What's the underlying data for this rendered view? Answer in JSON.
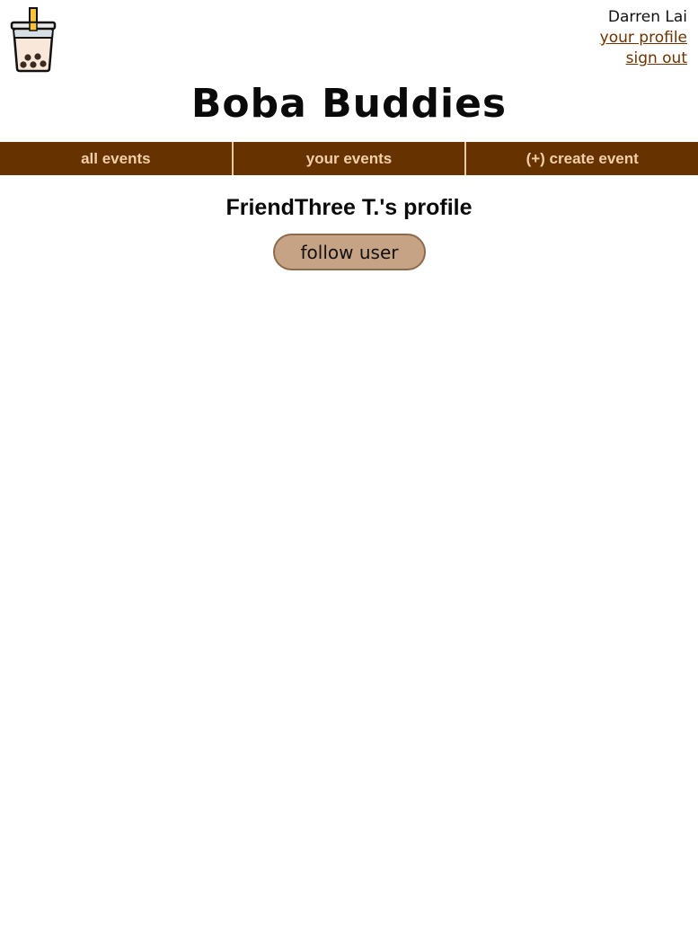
{
  "header": {
    "logo_icon": "boba-tea-cup-icon",
    "user_name": "Darren Lai",
    "profile_link": "your profile",
    "signout_link": "sign out",
    "title": "Boba Buddies"
  },
  "nav": {
    "items": [
      {
        "label": "all events"
      },
      {
        "label": "your events"
      },
      {
        "label": "(+) create event"
      }
    ]
  },
  "profile": {
    "heading": "FriendThree T.'s profile",
    "follow_label": "follow user"
  },
  "colors": {
    "nav_background": "#663300",
    "nav_text": "#f2cfa8",
    "link": "#6b3300",
    "button_background": "#c6a384",
    "button_border": "#8c6a4c"
  }
}
